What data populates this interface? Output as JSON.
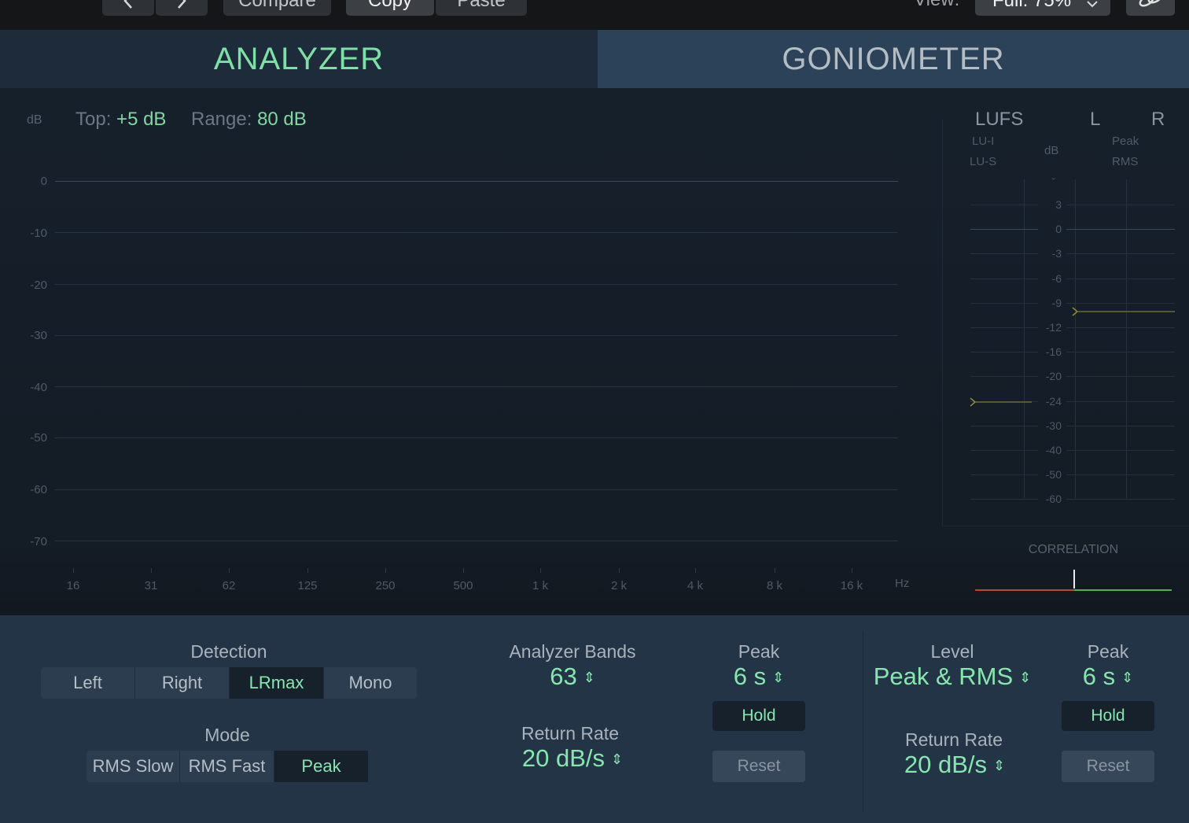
{
  "toolbar": {
    "back_icon": "chevron-left-icon",
    "forward_icon": "chevron-right-icon",
    "compare_label": "Compare",
    "copy_label": "Copy",
    "paste_label": "Paste",
    "view_label": "View:",
    "view_value": "Full: 75%",
    "link_icon": "link-icon"
  },
  "tabs": [
    {
      "label": "ANALYZER",
      "active": true
    },
    {
      "label": "GONIOMETER",
      "active": false
    }
  ],
  "analyzer": {
    "db_unit": "dB",
    "top_label": "Top:",
    "top_value": "+5 dB",
    "range_label": "Range:",
    "range_value": "80 dB",
    "y_ticks": [
      "0",
      "-10",
      "-20",
      "-30",
      "-40",
      "-50",
      "-60",
      "-70"
    ],
    "x_ticks": [
      "16",
      "31",
      "62",
      "125",
      "250",
      "500",
      "1 k",
      "2 k",
      "4 k",
      "8 k",
      "16 k"
    ],
    "x_unit": "Hz"
  },
  "meter": {
    "lufs_label": "LUFS",
    "lu_i_label": "LU-I",
    "lu_s_label": "LU-S",
    "db_label": "dB",
    "l_label": "L",
    "r_label": "R",
    "peak_label": "Peak",
    "rms_label": "RMS",
    "scale": [
      "3",
      "0",
      "-3",
      "-6",
      "-9",
      "-12",
      "-16",
      "-20",
      "-24",
      "-30",
      "-40",
      "-50",
      "-60"
    ],
    "lufs_marker_db": -24,
    "peak_marker_db": -10,
    "correlation_label": "CORRELATION",
    "correlation_value": 0.0,
    "colors": {
      "accent": "#86e7ad",
      "marker": "#8d8a3c",
      "corr_neg": "#c0442d",
      "corr_pos": "#55b04a"
    }
  },
  "panel": {
    "detection_label": "Detection",
    "detection_options": [
      "Left",
      "Right",
      "LRmax",
      "Mono"
    ],
    "detection_selected": "LRmax",
    "mode_label": "Mode",
    "mode_options": [
      "RMS Slow",
      "RMS Fast",
      "Peak"
    ],
    "mode_selected": "Peak",
    "bands_label": "Analyzer Bands",
    "bands_value": "63",
    "return_rate_label": "Return Rate",
    "return_rate_value": "20 dB/s",
    "peak_label": "Peak",
    "peak_value": "6 s",
    "hold_label": "Hold",
    "reset_label": "Reset",
    "level_label": "Level",
    "level_value": "Peak & RMS",
    "level_return_rate_label": "Return Rate",
    "level_return_rate_value": "20 dB/s",
    "level_peak_label": "Peak",
    "level_peak_value": "6 s",
    "level_hold_label": "Hold",
    "level_reset_label": "Reset",
    "stepper_icon": "up-down-stepper-icon"
  }
}
